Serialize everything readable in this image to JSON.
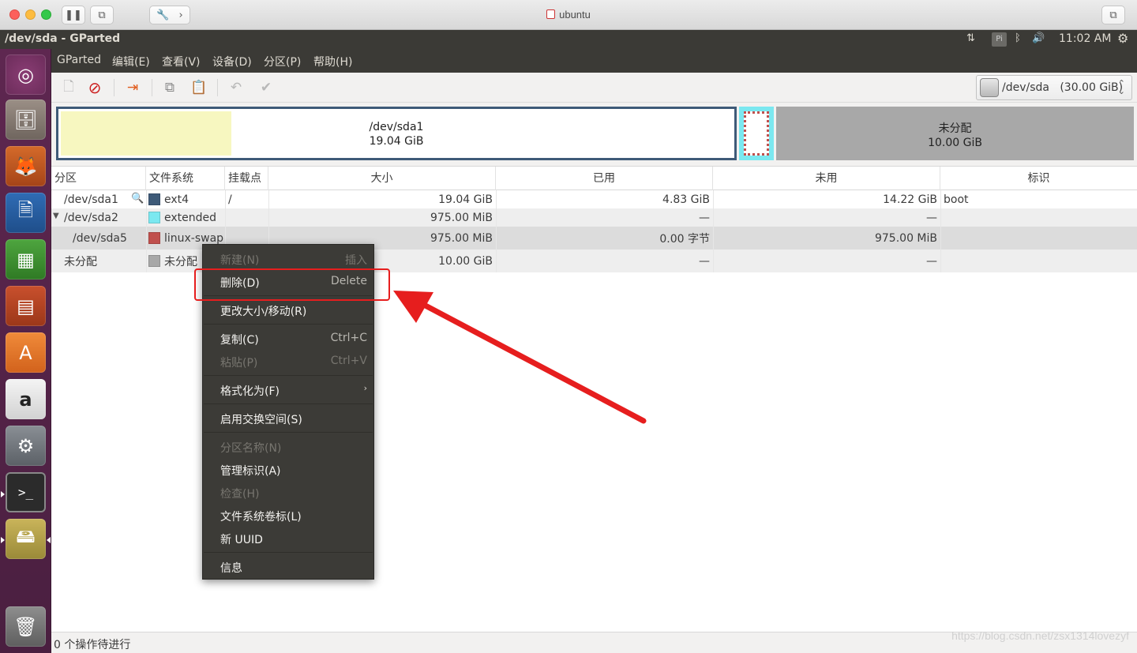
{
  "host": {
    "title": "ubuntu"
  },
  "panel": {
    "window_title": "/dev/sda - GParted",
    "pi_label": "Pi",
    "time": "11:02 AM"
  },
  "menubar": {
    "items": [
      "GParted",
      "编辑(E)",
      "查看(V)",
      "设备(D)",
      "分区(P)",
      "帮助(H)"
    ]
  },
  "toolbar": {
    "device_selector": "/dev/sda   (30.00 GiB)"
  },
  "partition_map": {
    "sda1": {
      "name": "/dev/sda1",
      "size": "19.04 GiB",
      "used_fraction": 0.254
    },
    "unallocated": {
      "name": "未分配",
      "size": "10.00 GiB"
    }
  },
  "table": {
    "columns": [
      "分区",
      "文件系统",
      "挂载点",
      "大小",
      "已用",
      "未用",
      "标识"
    ],
    "rows": [
      {
        "partition": "/dev/sda1",
        "fs": "ext4",
        "fs_color": "#3e5a78",
        "mount": "/",
        "size": "19.04 GiB",
        "used": "4.83 GiB",
        "unused": "14.22 GiB",
        "flags": "boot"
      },
      {
        "partition": "/dev/sda2",
        "fs": "extended",
        "fs_color": "#7be8f0",
        "mount": "",
        "size": "975.00 MiB",
        "used": "—",
        "unused": "—",
        "flags": ""
      },
      {
        "partition": "/dev/sda5",
        "fs": "linux-swap",
        "fs_color": "#c0504d",
        "mount": "",
        "size": "975.00 MiB",
        "used": "0.00 字节",
        "unused": "975.00 MiB",
        "flags": ""
      },
      {
        "partition": "未分配",
        "fs": "未分配",
        "fs_color": "#a8a8a8",
        "mount": "",
        "size": "10.00 GiB",
        "used": "—",
        "unused": "—",
        "flags": ""
      }
    ]
  },
  "context_menu": {
    "items": [
      {
        "label": "新建(N)",
        "accel": "插入",
        "enabled": false
      },
      {
        "label": "删除(D)",
        "accel": "Delete",
        "enabled": true
      },
      {
        "label": "更改大小/移动(R)",
        "accel": "",
        "enabled": true
      },
      {
        "label": "复制(C)",
        "accel": "Ctrl+C",
        "enabled": true
      },
      {
        "label": "粘贴(P)",
        "accel": "Ctrl+V",
        "enabled": false
      },
      {
        "label": "格式化为(F)",
        "accel": "",
        "enabled": true
      },
      {
        "label": "启用交换空间(S)",
        "accel": "",
        "enabled": true
      },
      {
        "label": "分区名称(N)",
        "accel": "",
        "enabled": false
      },
      {
        "label": "管理标识(A)",
        "accel": "",
        "enabled": true
      },
      {
        "label": "检查(H)",
        "accel": "",
        "enabled": false
      },
      {
        "label": "文件系统卷标(L)",
        "accel": "",
        "enabled": true
      },
      {
        "label": "新 UUID",
        "accel": "",
        "enabled": true
      },
      {
        "label": "信息",
        "accel": "",
        "enabled": true
      }
    ]
  },
  "status": {
    "text": "0 个操作待进行"
  },
  "watermark": "https://blog.csdn.net/zsx1314lovezyf",
  "colors": {
    "highlight": "#e61e1e",
    "menu_bg": "#3c3b37",
    "panel_bg": "#3b3a36",
    "launcher_bg": "#5e2750"
  }
}
